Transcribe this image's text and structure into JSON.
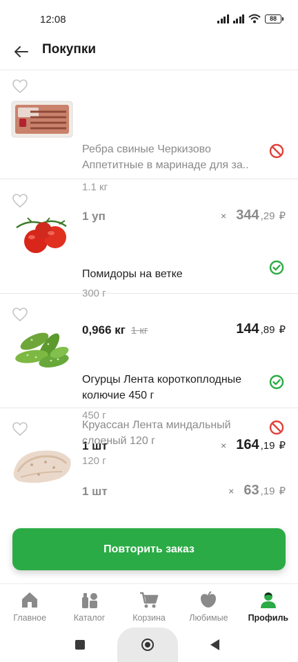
{
  "status_bar": {
    "time": "12:08",
    "battery": "88"
  },
  "header": {
    "title": "Покупки",
    "back_icon": "arrow-left-icon"
  },
  "items": [
    {
      "name": "Ребра свиные Черкизово Аппетитные в маринаде для за..",
      "weight": "1.1 кг",
      "qty": "1 уп",
      "qty_old": "",
      "rub": "344",
      "kop": ",29",
      "currency": "₽",
      "times": "×",
      "available": false,
      "status_icon": "unavailable-icon",
      "status_color": "#e0413a"
    },
    {
      "name": "Помидоры на ветке",
      "weight": "300 г",
      "qty": "0,966 кг",
      "qty_old": "1 кг",
      "rub": "144",
      "kop": ",89",
      "currency": "₽",
      "times": "",
      "available": true,
      "status_icon": "check-circle-icon",
      "status_color": "#2bab45"
    },
    {
      "name": "Огурцы Лента короткоплодные колючие 450 г",
      "weight": "450 г",
      "qty": "1 шт",
      "qty_old": "",
      "rub": "164",
      "kop": ",19",
      "currency": "₽",
      "times": "×",
      "available": true,
      "status_icon": "check-circle-icon",
      "status_color": "#2bab45"
    },
    {
      "name": "Круассан Лента миндальный слоеный 120 г",
      "weight": "120 г",
      "qty": "1 шт",
      "qty_old": "",
      "rub": "63",
      "kop": ",19",
      "currency": "₽",
      "times": "×",
      "available": false,
      "status_icon": "unavailable-icon",
      "status_color": "#e0413a"
    }
  ],
  "repeat_button": {
    "label": "Повторить заказ",
    "color": "#2bab45"
  },
  "bottom_nav": [
    {
      "label": "Главное",
      "icon": "home-icon",
      "active": false
    },
    {
      "label": "Каталог",
      "icon": "catalog-icon",
      "active": false
    },
    {
      "label": "Корзина",
      "icon": "cart-icon",
      "active": false
    },
    {
      "label": "Любимые",
      "icon": "apple-heart-icon",
      "active": false
    },
    {
      "label": "Профиль",
      "icon": "profile-icon",
      "active": true
    }
  ],
  "colors": {
    "accent": "#2bab45",
    "error": "#e0413a",
    "muted": "#8a8a8a",
    "nav_inactive": "#888888"
  }
}
